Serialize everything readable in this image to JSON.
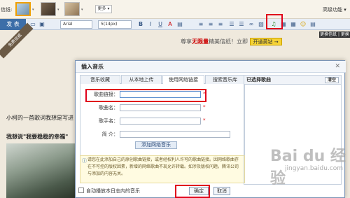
{
  "paper": {
    "label": "信纸:",
    "more_label": "更多 ▾",
    "advanced_label": "高级功能 ▾"
  },
  "toolbar": {
    "send_label": "发 表",
    "font_family": "Arial",
    "font_size": "5(14px)",
    "change_letter_label": "更换信纸 | 更换"
  },
  "ribbon": {
    "label": "免费信纸"
  },
  "promo": {
    "prefix": "尊享",
    "highlight": "无限量",
    "suffix": "精美信纸！立即",
    "button_label": "开通黄钻 →"
  },
  "body": {
    "line": "小柯的一首歌词我想是写进",
    "title": "我想说\"我要稳稳的幸福\""
  },
  "dialog": {
    "title": "插入音乐",
    "close": "✕",
    "tabs": [
      "音乐收藏",
      "从本地上传",
      "使用网络链接",
      "搜索音乐库"
    ],
    "fields": {
      "song_link_label": "歌曲链接：",
      "song_name_label": "歌曲名：",
      "singer_label": "歌手名：",
      "intro_label": "简  介："
    },
    "add_button": "添加网络音乐",
    "notice": "请您在此添加自己的原创歌曲链接，或者经权利人许可的歌曲链接。因网络歌曲存在不可控的版权因素，新增的网络歌曲不现允许转载。如涉及版权问题，腾讯公司与添加的内容无关。",
    "selected_header": "已选择歌曲",
    "clear_label": "清空",
    "auto_play_label": "自动播放本日志内的音乐",
    "ok_label": "确定",
    "cancel_label": "取消"
  },
  "watermark": {
    "main": "Bai du 经验",
    "sub": "jingyan.baidu.com"
  },
  "colors": {
    "accent": "#3d6ea8",
    "highlight_box": "#e0001b"
  }
}
